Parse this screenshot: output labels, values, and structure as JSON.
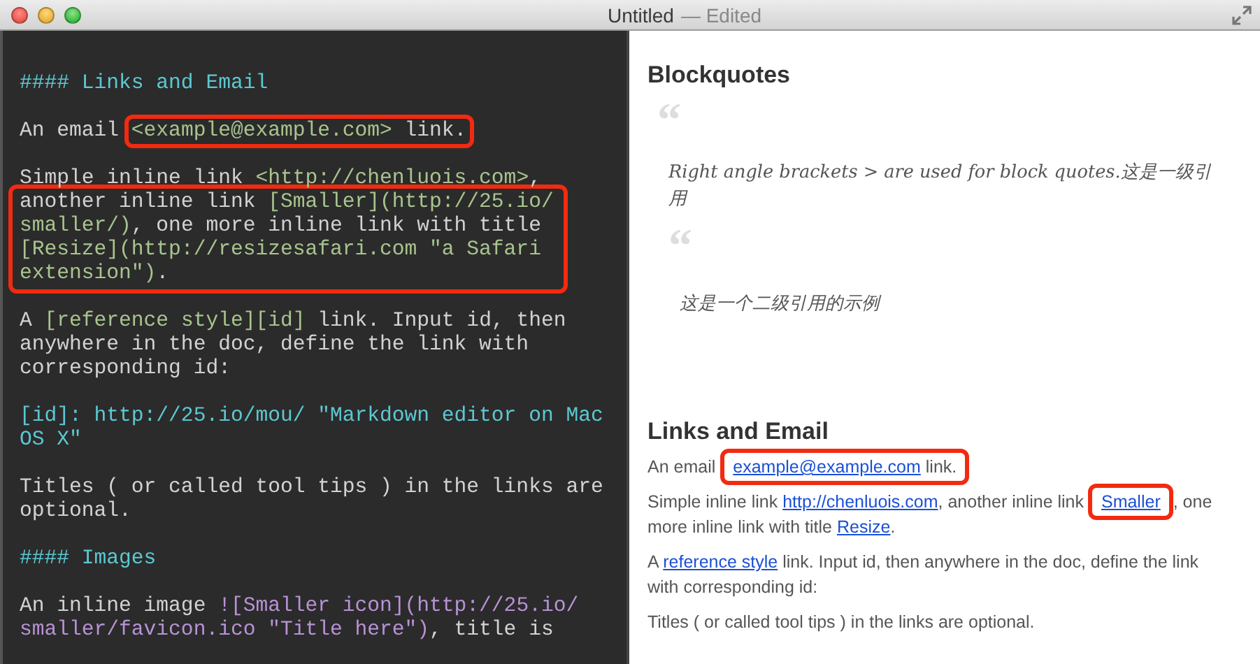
{
  "window": {
    "title": "Untitled",
    "status": "— Edited"
  },
  "editor": {
    "paragraphs": [
      {
        "lines": [
          {
            "highlighted": false,
            "segments": [
              {
                "kind": "heading",
                "text": "#### Links and Email",
                "highlighted": false
              }
            ]
          }
        ]
      },
      {
        "lines": [
          {
            "highlighted": false,
            "segments": [
              {
                "kind": "text",
                "text": "An email ",
                "highlighted": false
              },
              {
                "kind": "link",
                "text": "<example@example.com>",
                "highlighted": true
              },
              {
                "kind": "text",
                "text": " link.",
                "highlighted": true
              }
            ]
          }
        ]
      },
      {
        "lines": [
          {
            "highlighted": false,
            "segments": [
              {
                "kind": "text",
                "text": "Simple inline link ",
                "highlighted": false
              },
              {
                "kind": "link",
                "text": "<http://chenluois.com>",
                "highlighted": false
              },
              {
                "kind": "text",
                "text": ",",
                "highlighted": false
              }
            ]
          },
          {
            "highlighted": true,
            "segments": [
              {
                "kind": "text",
                "text": "another inline link ",
                "highlighted": false
              },
              {
                "kind": "link",
                "text": "[Smaller](http://25.io/",
                "highlighted": false
              }
            ]
          },
          {
            "highlighted": true,
            "segments": [
              {
                "kind": "link",
                "text": "smaller/)",
                "highlighted": false
              },
              {
                "kind": "text",
                "text": ", one more inline link with title",
                "highlighted": false
              }
            ]
          },
          {
            "highlighted": true,
            "segments": [
              {
                "kind": "link",
                "text": "[Resize](http://resizesafari.com \"a Safari",
                "highlighted": false
              }
            ]
          },
          {
            "highlighted": true,
            "segments": [
              {
                "kind": "link",
                "text": "extension\")",
                "highlighted": false
              },
              {
                "kind": "text",
                "text": ".",
                "highlighted": false
              }
            ]
          }
        ]
      },
      {
        "lines": [
          {
            "highlighted": false,
            "segments": [
              {
                "kind": "text",
                "text": "A ",
                "highlighted": false
              },
              {
                "kind": "link",
                "text": "[reference style][id]",
                "highlighted": false
              },
              {
                "kind": "text",
                "text": " link. Input id, then",
                "highlighted": false
              }
            ]
          },
          {
            "highlighted": false,
            "segments": [
              {
                "kind": "text",
                "text": "anywhere in the doc, define the link with",
                "highlighted": false
              }
            ]
          },
          {
            "highlighted": false,
            "segments": [
              {
                "kind": "text",
                "text": "corresponding id:",
                "highlighted": false
              }
            ]
          }
        ]
      },
      {
        "lines": [
          {
            "highlighted": false,
            "segments": [
              {
                "kind": "reference",
                "text": "[id]: http://25.io/mou/ \"Markdown editor on Mac",
                "highlighted": false
              }
            ]
          },
          {
            "highlighted": false,
            "segments": [
              {
                "kind": "reference",
                "text": "OS X\"",
                "highlighted": false
              }
            ]
          }
        ]
      },
      {
        "lines": [
          {
            "highlighted": false,
            "segments": [
              {
                "kind": "text",
                "text": "Titles ( or called tool tips ) in the links are",
                "highlighted": false
              }
            ]
          },
          {
            "highlighted": false,
            "segments": [
              {
                "kind": "text",
                "text": "optional.",
                "highlighted": false
              }
            ]
          }
        ]
      },
      {
        "lines": [
          {
            "highlighted": false,
            "segments": [
              {
                "kind": "heading",
                "text": "#### Images",
                "highlighted": false
              }
            ]
          }
        ]
      },
      {
        "lines": [
          {
            "highlighted": false,
            "segments": [
              {
                "kind": "text",
                "text": "An inline image ",
                "highlighted": false
              },
              {
                "kind": "image",
                "text": "![Smaller icon](http://25.io/",
                "highlighted": false
              }
            ]
          },
          {
            "highlighted": false,
            "segments": [
              {
                "kind": "image",
                "text": "smaller/favicon.ico \"Title here\")",
                "highlighted": false
              },
              {
                "kind": "text",
                "text": ", title is",
                "highlighted": false
              }
            ]
          }
        ]
      }
    ]
  },
  "preview": {
    "blocks": [
      {
        "kind": "heading",
        "text": "Blockquotes"
      },
      {
        "kind": "quote",
        "mark": "“",
        "text": "Right angle brackets > are used for block quotes.这是一级引用",
        "children": [
          {
            "kind": "quote",
            "mark": "“",
            "text": "这是一个二级引用的示例"
          }
        ]
      },
      {
        "kind": "heading",
        "text": "Links and Email"
      },
      {
        "kind": "paragraph",
        "segments": [
          {
            "kind": "text",
            "text": "An email",
            "highlighted": false
          },
          {
            "kind": "link",
            "text": "example@example.com",
            "highlighted": true
          },
          {
            "kind": "text",
            "text": "link.",
            "highlighted": true
          }
        ]
      },
      {
        "kind": "paragraph",
        "segments": [
          {
            "kind": "text",
            "text": "Simple inline link",
            "highlighted": false
          },
          {
            "kind": "link",
            "text": "http://chenluois.com",
            "highlighted": false
          },
          {
            "kind": "text",
            "text": ", another inline link",
            "highlighted": false
          },
          {
            "kind": "link",
            "text": "Smaller",
            "highlighted": true
          },
          {
            "kind": "text",
            "text": ", one more inline link with title",
            "highlighted": false
          },
          {
            "kind": "link",
            "text": "Resize",
            "highlighted": false
          },
          {
            "kind": "text",
            "text": ".",
            "highlighted": false
          }
        ]
      },
      {
        "kind": "paragraph",
        "segments": [
          {
            "kind": "text",
            "text": "A",
            "highlighted": false
          },
          {
            "kind": "link",
            "text": "reference style",
            "highlighted": false
          },
          {
            "kind": "text",
            "text": "link. Input id, then anywhere in the doc, define the link with corresponding id:",
            "highlighted": false
          }
        ]
      },
      {
        "kind": "paragraph",
        "segments": [
          {
            "kind": "text",
            "text": "Titles ( or called tool tips ) in the links are optional.",
            "highlighted": false
          }
        ]
      }
    ]
  }
}
